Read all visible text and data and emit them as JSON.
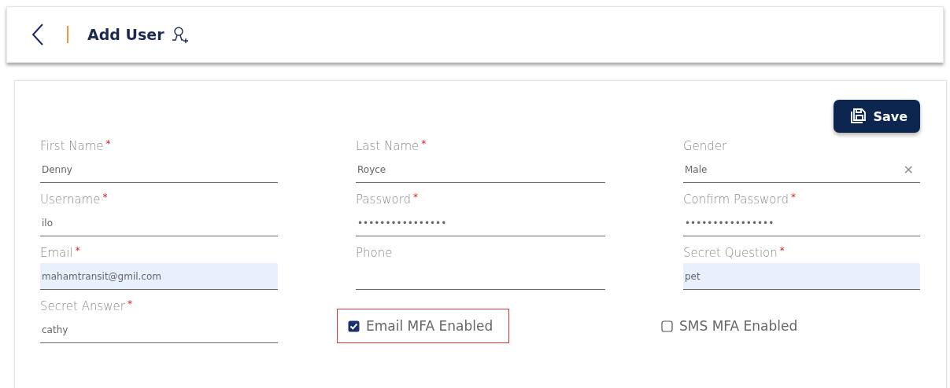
{
  "header": {
    "title": "Add User"
  },
  "save_button": {
    "label": "Save"
  },
  "fields": [
    {
      "label": "First Name",
      "required_mark": "*",
      "value": "Denny",
      "kind": "text",
      "highlighted": false
    },
    {
      "label": "Last Name",
      "required_mark": "*",
      "value": "Royce",
      "kind": "text",
      "highlighted": false
    },
    {
      "label": "Gender",
      "value": "Male",
      "kind": "select",
      "highlighted": false,
      "clear": "×"
    },
    {
      "label": "Username",
      "required_mark": "*",
      "value": "ilo",
      "kind": "text",
      "highlighted": false
    },
    {
      "label": "Password",
      "required_mark": "*",
      "value": "••••••••••••••••",
      "kind": "text",
      "highlighted": false
    },
    {
      "label": "Confirm Password",
      "required_mark": "*",
      "value": "••••••••••••••••",
      "kind": "text",
      "highlighted": false
    },
    {
      "label": "Email",
      "required_mark": "*",
      "value": "mahamtransit@gmil.com",
      "kind": "text",
      "highlighted": true
    },
    {
      "label": "Phone",
      "kind": "text",
      "highlighted": false
    },
    {
      "label": "Secret Question",
      "required_mark": "*",
      "value": "pet",
      "kind": "text",
      "highlighted": true
    },
    {
      "label": "Secret Answer",
      "required_mark": "*",
      "value": "cathy",
      "kind": "text",
      "highlighted": false
    }
  ],
  "checkboxes": [
    {
      "label": "Email MFA Enabled",
      "checked": true,
      "outlined": true
    },
    {
      "label": "SMS MFA Enabled",
      "checked": false,
      "outlined": false
    }
  ]
}
